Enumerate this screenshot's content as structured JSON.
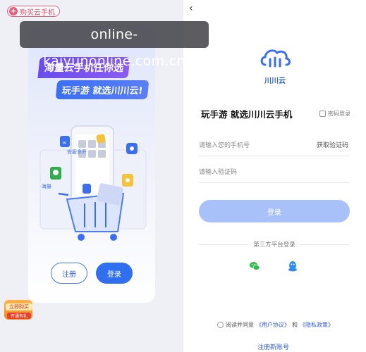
{
  "top_badge": {
    "label": "购买云手机"
  },
  "watermark": "online-kaiyunonline.com.cn",
  "promo": {
    "banner_line1": "海量云手机任你选",
    "banner_line2": "玩手游 就选川川云!",
    "tag_multi_open": "安服多开",
    "tag_fire": "海量",
    "btn_register": "注册",
    "btn_login": "登录"
  },
  "gift": {
    "line1": "立即购买",
    "line2": "开通有礼"
  },
  "login": {
    "headline": "玩手游 就选川川云手机",
    "password_login": "密码登录",
    "phone_placeholder": "请输入您的手机号",
    "get_code": "获取验证码",
    "code_placeholder": "请输入验证码",
    "login_button": "登录",
    "third_party_label": "第三方平台登录",
    "agree_prefix": "阅读并同意",
    "user_agreement": "《用户协议》",
    "and": "和",
    "privacy_policy": "《隐私政策》",
    "register_new": "注册新账号"
  },
  "brand": {
    "logo_text": "川川云"
  },
  "colors": {
    "primary": "#2f6ff0",
    "login_disabled": "#a8c1f8",
    "badge": "#e85a78",
    "wechat": "#2bbf4a",
    "qq": "#2f8cf0"
  },
  "icons": {
    "back": "chevron-left-icon",
    "wechat": "wechat-icon",
    "qq": "qq-icon",
    "lock": "lock-icon",
    "cloud_logo": "cloud-logo-icon"
  }
}
